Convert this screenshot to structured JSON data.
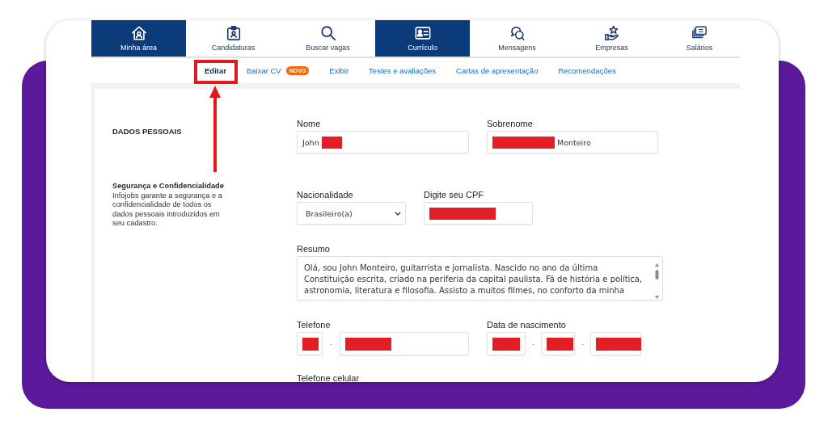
{
  "nav": {
    "items": [
      {
        "label": "Minha área",
        "selected": true
      },
      {
        "label": "Candidaturas",
        "selected": false
      },
      {
        "label": "Buscar vagas",
        "selected": false
      },
      {
        "label": "Currículo",
        "selected": true
      },
      {
        "label": "Mensagens",
        "selected": false
      },
      {
        "label": "Empresas",
        "selected": false
      },
      {
        "label": "Salários",
        "selected": false
      }
    ]
  },
  "subnav": {
    "items": [
      {
        "label": "Editar",
        "selected": true
      },
      {
        "label": "Baixar CV",
        "badge": "NOVO",
        "selected": false
      },
      {
        "label": "Exibir",
        "selected": false
      },
      {
        "label": "Testes e avaliações",
        "selected": false
      },
      {
        "label": "Cartas de apresentação",
        "selected": false
      },
      {
        "label": "Recomendações",
        "selected": false
      }
    ]
  },
  "sidebar": {
    "section_title": "DADOS PESSOAIS",
    "note_title": "Segurança e Confidencialidade",
    "note_text": "Infojobs garante a segurança e a confidencialidade de todos os dados pessoais introduzidos em seu cadastro."
  },
  "form": {
    "rows": [
      {
        "fields": [
          {
            "kind": "text",
            "label": "Nome",
            "parts": [
              {
                "kind": "text",
                "text": "John"
              },
              {
                "kind": "redaction"
              }
            ]
          },
          {
            "kind": "text",
            "label": "Sobrenome",
            "parts": [
              {
                "kind": "redaction"
              },
              {
                "kind": "text",
                "text": "Monteiro"
              }
            ]
          }
        ]
      },
      {
        "fields": [
          {
            "kind": "select",
            "label": "Nacionalidade",
            "value": "Brasileiro(a)"
          },
          {
            "kind": "text",
            "label": "Digite seu CPF",
            "parts": [
              {
                "kind": "redaction"
              }
            ]
          }
        ]
      },
      {
        "fields": [
          {
            "kind": "textarea",
            "label": "Resumo",
            "lines": [
              "Olá, sou John Monteiro, guitarrista e jornalista. Nascido no ano da última",
              "Constituição escrita, criado na periferia da capital paulista. Fã de história e política,",
              "astronomia, literatura e filosofia. Assisto a muitos filmes, no conforto da minha"
            ]
          }
        ]
      },
      {
        "fields": [
          {
            "kind": "split",
            "label": "Telefone",
            "separators": [
              "-"
            ],
            "segments": [
              {
                "parts": [
                  {
                    "kind": "redaction"
                  }
                ]
              },
              {
                "parts": [
                  {
                    "kind": "redaction"
                  }
                ]
              }
            ]
          },
          {
            "kind": "split",
            "label": "Data de nascimento",
            "separators": [
              "-",
              "-"
            ],
            "segments": [
              {
                "parts": [
                  {
                    "kind": "redaction"
                  }
                ]
              },
              {
                "parts": [
                  {
                    "kind": "redaction"
                  }
                ]
              },
              {
                "parts": [
                  {
                    "kind": "redaction"
                  }
                ]
              }
            ]
          }
        ]
      },
      {
        "fields": [
          {
            "kind": "label",
            "label": "Telefone celular"
          }
        ]
      }
    ]
  }
}
